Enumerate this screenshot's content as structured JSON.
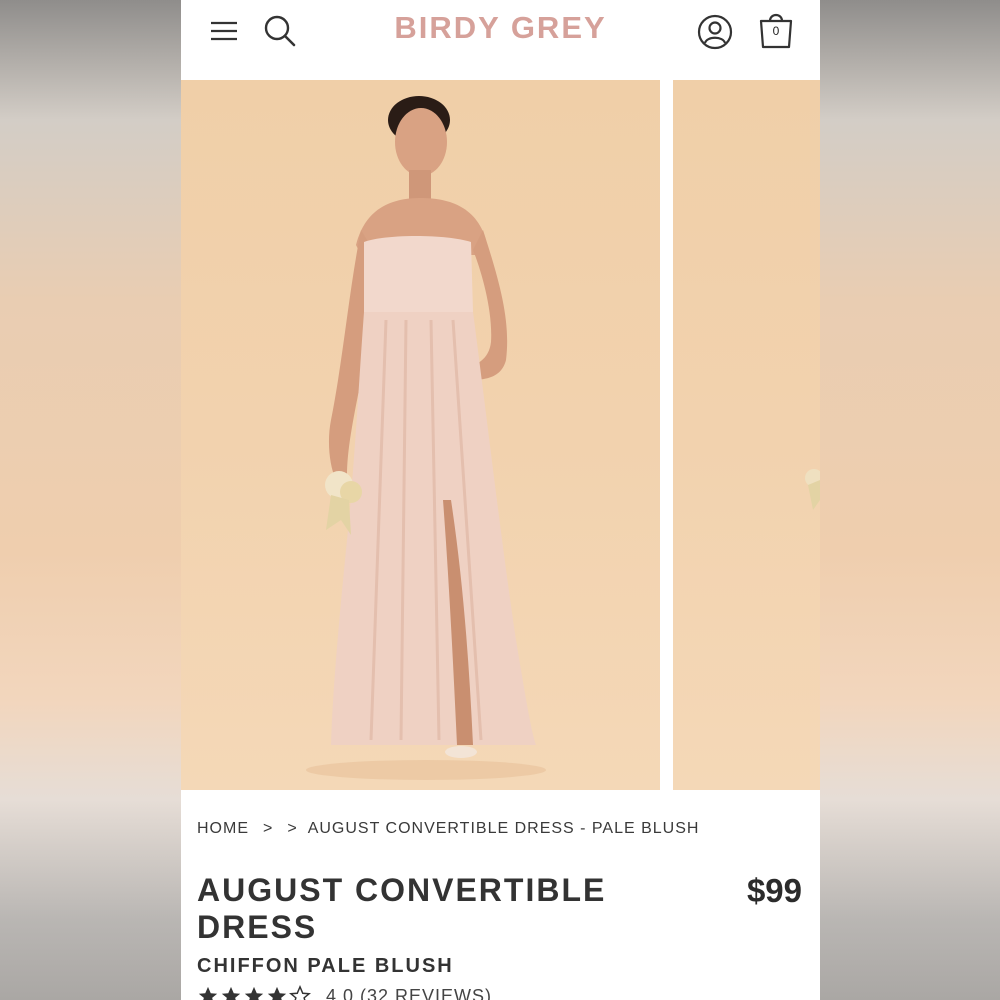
{
  "header": {
    "logo_text": "BIRDY GREY",
    "cart_count": "0",
    "brand_color": "#d6a19a",
    "icons": [
      "hamburger-menu-icon",
      "search-icon",
      "account-icon",
      "shopping-bag-icon"
    ]
  },
  "gallery": {
    "images": [
      {
        "alt": "Model wearing strapless pale blush chiffon gown with front slit, holding small bouquet"
      },
      {
        "alt": "Partial second product image"
      }
    ],
    "background_color": "#f1d1ac",
    "dress_color": "#f0d3c6"
  },
  "breadcrumb": {
    "home": "HOME",
    "separator_1": ">",
    "separator_2": ">",
    "current": "AUGUST CONVERTIBLE DRESS - PALE BLUSH"
  },
  "product": {
    "title": "AUGUST CONVERTIBLE DRESS",
    "price": "$99",
    "subtitle": "CHIFFON PALE BLUSH",
    "rating_value": 4.0,
    "rating_text": "4.0 (32 REVIEWS)",
    "stars_filled": 4,
    "stars_total": 5
  }
}
